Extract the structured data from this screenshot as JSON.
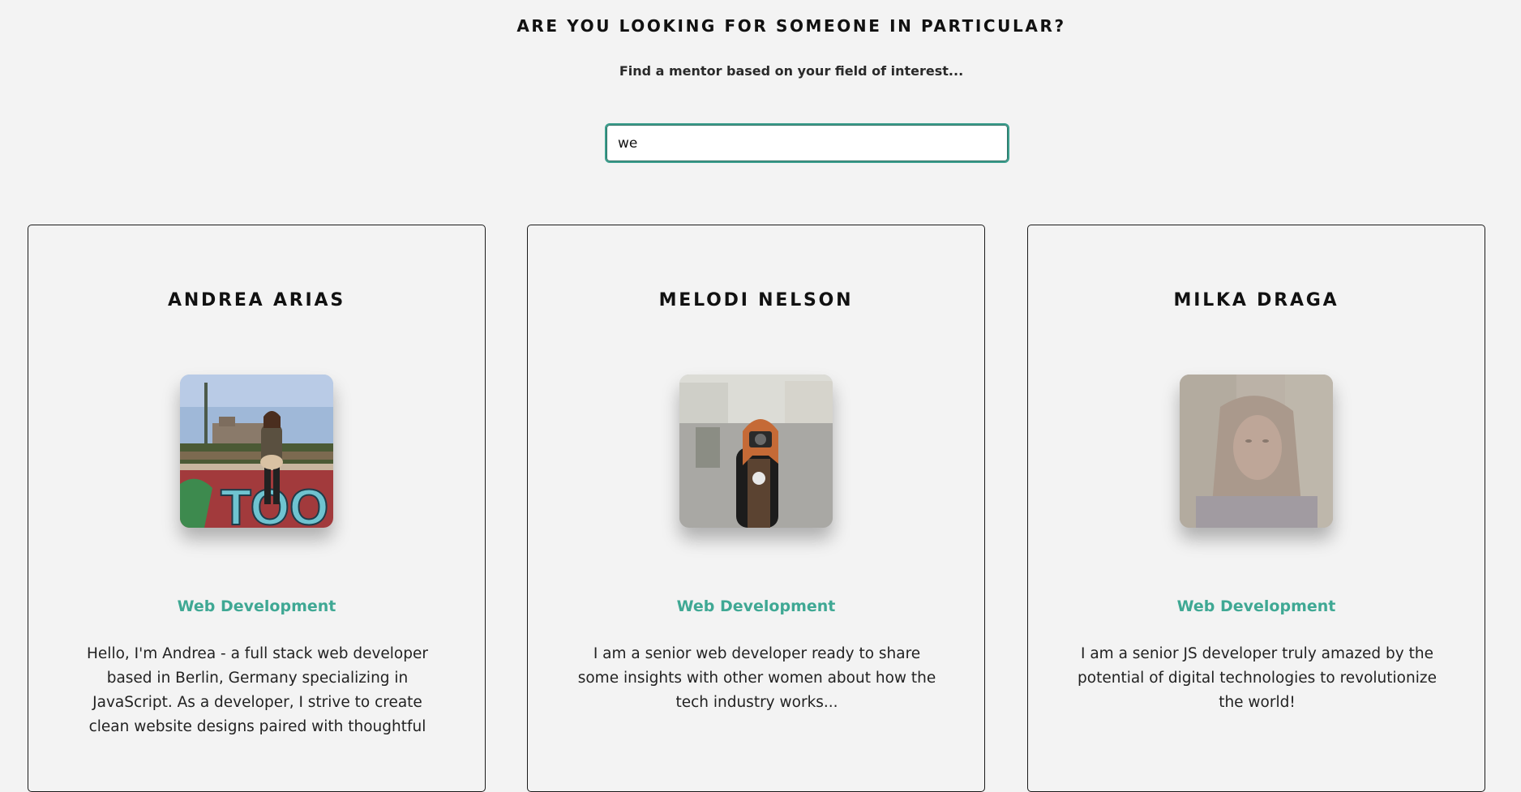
{
  "page": {
    "title": "ARE YOU LOOKING FOR SOMEONE IN PARTICULAR?",
    "subtitle": "Find a mentor based on your field of interest..."
  },
  "search": {
    "value": "we"
  },
  "colors": {
    "accent": "#3fa894",
    "input_border": "#3a9d8c",
    "background": "#f3f3f3"
  },
  "mentors": [
    {
      "name": "ANDREA ARIAS",
      "field": "Web Development",
      "bio": "Hello, I'm Andrea - a full stack web developer based in Berlin, Germany specializing in JavaScript. As a developer, I strive to create clean website designs paired with thoughtful"
    },
    {
      "name": "MELODI NELSON",
      "field": "Web Development",
      "bio": "I am a senior web developer ready to share some insights with other women about how the tech industry works..."
    },
    {
      "name": "MILKA DRAGA",
      "field": "Web Development",
      "bio": "I am a senior JS developer truly amazed by the potential of digital technologies to revolutionize the world!"
    }
  ]
}
